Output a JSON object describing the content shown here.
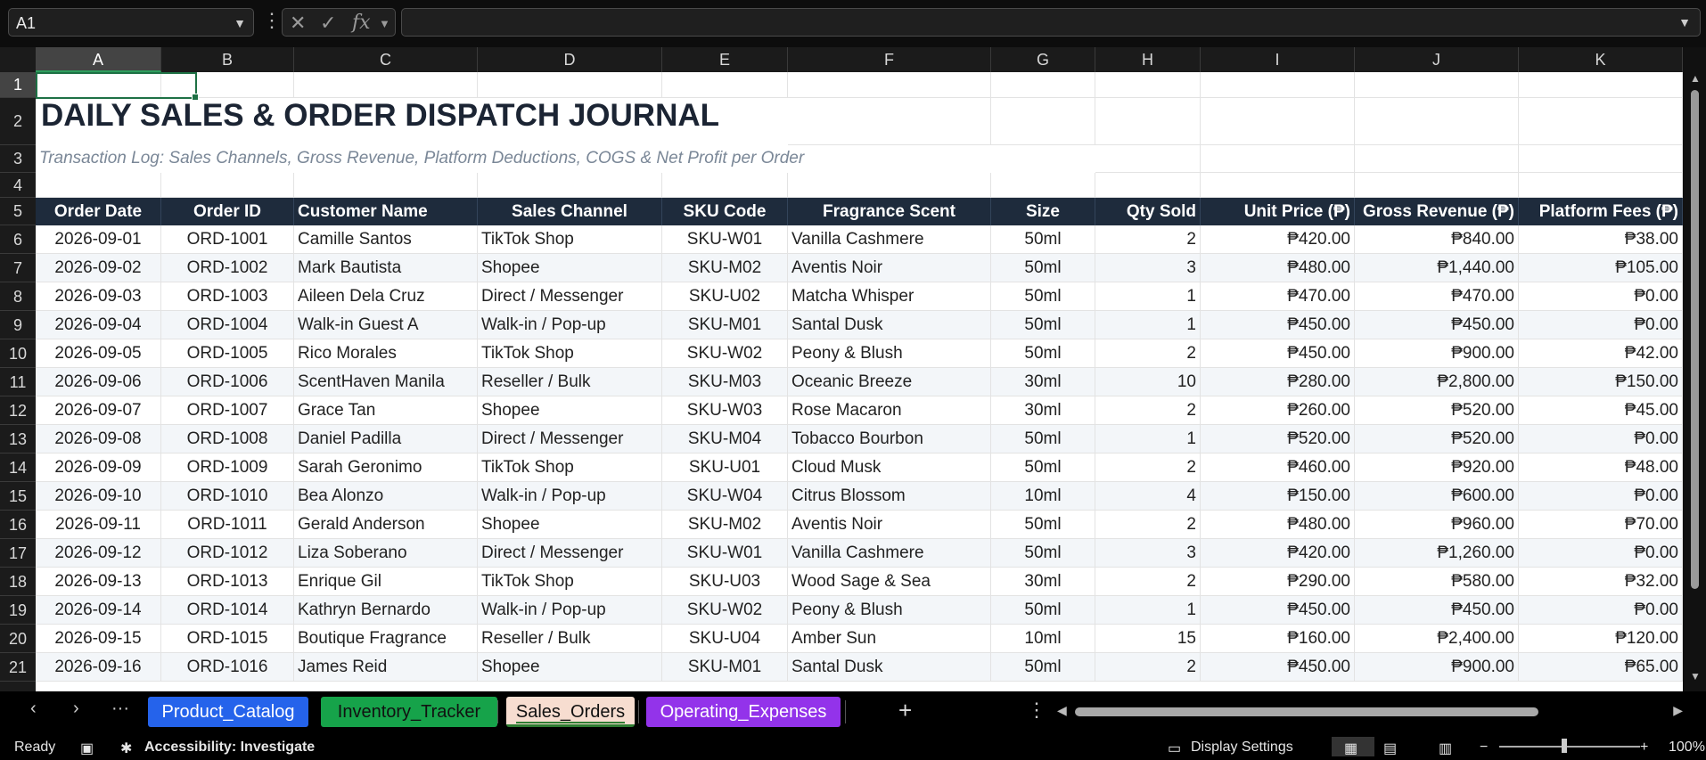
{
  "formula_bar": {
    "name_box": "A1",
    "formula": "",
    "cancel_icon": "✕",
    "enter_icon": "✓",
    "fx_label": "fx"
  },
  "columns": [
    "A",
    "B",
    "C",
    "D",
    "E",
    "F",
    "G",
    "H",
    "I",
    "J",
    "K"
  ],
  "rows": [
    "1",
    "2",
    "3",
    "4",
    "5",
    "6",
    "7",
    "8",
    "9",
    "10",
    "11",
    "12",
    "13",
    "14",
    "15",
    "16",
    "17",
    "18",
    "19",
    "20",
    "21"
  ],
  "sheet": {
    "title": "DAILY SALES & ORDER DISPATCH JOURNAL",
    "subtitle": "Transaction Log: Sales Channels, Gross Revenue, Platform Deductions, COGS & Net Profit per Order",
    "headers": [
      "Order Date",
      "Order ID",
      "Customer Name",
      "Sales Channel",
      "SKU Code",
      "Fragrance Scent",
      "Size",
      "Qty Sold",
      "Unit Price (₱)",
      "Gross Revenue (₱)",
      "Platform Fees (₱)"
    ],
    "data": [
      [
        "2026-09-01",
        "ORD-1001",
        "Camille Santos",
        "TikTok Shop",
        "SKU-W01",
        "Vanilla Cashmere",
        "50ml",
        "2",
        "₱420.00",
        "₱840.00",
        "₱38.00"
      ],
      [
        "2026-09-02",
        "ORD-1002",
        "Mark Bautista",
        "Shopee",
        "SKU-M02",
        "Aventis Noir",
        "50ml",
        "3",
        "₱480.00",
        "₱1,440.00",
        "₱105.00"
      ],
      [
        "2026-09-03",
        "ORD-1003",
        "Aileen Dela Cruz",
        "Direct / Messenger",
        "SKU-U02",
        "Matcha Whisper",
        "50ml",
        "1",
        "₱470.00",
        "₱470.00",
        "₱0.00"
      ],
      [
        "2026-09-04",
        "ORD-1004",
        "Walk-in Guest A",
        "Walk-in / Pop-up",
        "SKU-M01",
        "Santal Dusk",
        "50ml",
        "1",
        "₱450.00",
        "₱450.00",
        "₱0.00"
      ],
      [
        "2026-09-05",
        "ORD-1005",
        "Rico Morales",
        "TikTok Shop",
        "SKU-W02",
        "Peony & Blush",
        "50ml",
        "2",
        "₱450.00",
        "₱900.00",
        "₱42.00"
      ],
      [
        "2026-09-06",
        "ORD-1006",
        "ScentHaven Manila",
        "Reseller / Bulk",
        "SKU-M03",
        "Oceanic Breeze",
        "30ml",
        "10",
        "₱280.00",
        "₱2,800.00",
        "₱150.00"
      ],
      [
        "2026-09-07",
        "ORD-1007",
        "Grace Tan",
        "Shopee",
        "SKU-W03",
        "Rose Macaron",
        "30ml",
        "2",
        "₱260.00",
        "₱520.00",
        "₱45.00"
      ],
      [
        "2026-09-08",
        "ORD-1008",
        "Daniel Padilla",
        "Direct / Messenger",
        "SKU-M04",
        "Tobacco Bourbon",
        "50ml",
        "1",
        "₱520.00",
        "₱520.00",
        "₱0.00"
      ],
      [
        "2026-09-09",
        "ORD-1009",
        "Sarah Geronimo",
        "TikTok Shop",
        "SKU-U01",
        "Cloud Musk",
        "50ml",
        "2",
        "₱460.00",
        "₱920.00",
        "₱48.00"
      ],
      [
        "2026-09-10",
        "ORD-1010",
        "Bea Alonzo",
        "Walk-in / Pop-up",
        "SKU-W04",
        "Citrus Blossom",
        "10ml",
        "4",
        "₱150.00",
        "₱600.00",
        "₱0.00"
      ],
      [
        "2026-09-11",
        "ORD-1011",
        "Gerald Anderson",
        "Shopee",
        "SKU-M02",
        "Aventis Noir",
        "50ml",
        "2",
        "₱480.00",
        "₱960.00",
        "₱70.00"
      ],
      [
        "2026-09-12",
        "ORD-1012",
        "Liza Soberano",
        "Direct / Messenger",
        "SKU-W01",
        "Vanilla Cashmere",
        "50ml",
        "3",
        "₱420.00",
        "₱1,260.00",
        "₱0.00"
      ],
      [
        "2026-09-13",
        "ORD-1013",
        "Enrique Gil",
        "TikTok Shop",
        "SKU-U03",
        "Wood Sage & Sea",
        "30ml",
        "2",
        "₱290.00",
        "₱580.00",
        "₱32.00"
      ],
      [
        "2026-09-14",
        "ORD-1014",
        "Kathryn Bernardo",
        "Walk-in / Pop-up",
        "SKU-W02",
        "Peony & Blush",
        "50ml",
        "1",
        "₱450.00",
        "₱450.00",
        "₱0.00"
      ],
      [
        "2026-09-15",
        "ORD-1015",
        "Boutique Fragrance",
        "Reseller / Bulk",
        "SKU-U04",
        "Amber Sun",
        "10ml",
        "15",
        "₱160.00",
        "₱2,400.00",
        "₱120.00"
      ],
      [
        "2026-09-16",
        "ORD-1016",
        "James Reid",
        "Shopee",
        "SKU-M01",
        "Santal Dusk",
        "50ml",
        "2",
        "₱450.00",
        "₱900.00",
        "₱65.00"
      ]
    ]
  },
  "tabs": [
    {
      "label": "Product_Catalog",
      "color": "#2563eb",
      "active": false
    },
    {
      "label": "Inventory_Tracker",
      "color": "#16a34a",
      "active": false
    },
    {
      "label": "Sales_Orders",
      "color": "#f7ddd0",
      "active": true
    },
    {
      "label": "Operating_Expenses",
      "color": "#9333ea",
      "active": false
    }
  ],
  "status": {
    "ready": "Ready",
    "accessibility": "Accessibility: Investigate",
    "display_settings": "Display Settings",
    "zoom": "100%"
  }
}
